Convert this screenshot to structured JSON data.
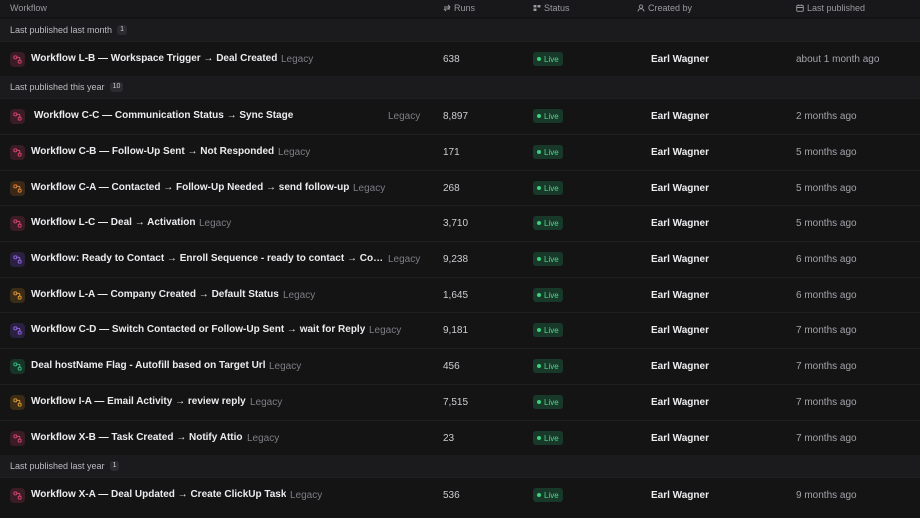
{
  "header": {
    "workflow": "Workflow",
    "runs": "Runs",
    "status": "Status",
    "created_by": "Created by",
    "last_published": "Last published"
  },
  "groups": [
    {
      "label": "Last published last month",
      "count": "1"
    },
    {
      "label": "Last published this year",
      "count": "10"
    },
    {
      "label": "Last published last year",
      "count": "1"
    }
  ],
  "rows": [
    {
      "name": "Workflow L-B — Workspace Trigger → Deal Created",
      "legacy": "Legacy",
      "runs": "638",
      "status": "Live",
      "creator": "Earl Wagner",
      "published": "about 1 month ago",
      "icon_color": "#e24a72",
      "icon_bg": "#3a1c26",
      "icon": "workflow-icon"
    },
    {
      "name": "Workflow C-C — Communication Status → Sync Stage",
      "legacy": "Legacy",
      "runs": "8,897",
      "status": "Live",
      "creator": "Earl Wagner",
      "published": "2 months ago",
      "icon_color": "#e24a72",
      "icon_bg": "#3a1c26",
      "icon": "workflow-icon"
    },
    {
      "name": "Workflow C-B — Follow-Up Sent → Not Responded",
      "legacy": "Legacy",
      "runs": "171",
      "status": "Live",
      "creator": "Earl Wagner",
      "published": "5 months ago",
      "icon_color": "#e24a72",
      "icon_bg": "#3a1c26",
      "icon": "workflow-icon"
    },
    {
      "name": "Workflow C-A — Contacted → Follow-Up Needed → send follow-up",
      "legacy": "Legacy",
      "runs": "268",
      "status": "Live",
      "creator": "Earl Wagner",
      "published": "5 months ago",
      "icon_color": "#f08a3a",
      "icon_bg": "#3a2818",
      "icon": "workflow-icon"
    },
    {
      "name": "Workflow L-C — Deal → Activation",
      "legacy": "Legacy",
      "runs": "3,710",
      "status": "Live",
      "creator": "Earl Wagner",
      "published": "5 months ago",
      "icon_color": "#e24a72",
      "icon_bg": "#3a1c26",
      "icon": "workflow-icon"
    },
    {
      "name": "Workflow: Ready to Contact → Enroll Sequence - ready to contact → Contac...",
      "legacy": "Legacy",
      "runs": "9,238",
      "status": "Live",
      "creator": "Earl Wagner",
      "published": "6 months ago",
      "icon_color": "#9a6cf0",
      "icon_bg": "#2a2040",
      "icon": "workflow-icon"
    },
    {
      "name": "Workflow L-A — Company Created → Default Status",
      "legacy": "Legacy",
      "runs": "1,645",
      "status": "Live",
      "creator": "Earl Wagner",
      "published": "6 months ago",
      "icon_color": "#f0a23a",
      "icon_bg": "#3a2c16",
      "icon": "workflow-icon"
    },
    {
      "name": "Workflow C-D — Switch Contacted or Follow-Up Sent → wait for Reply",
      "legacy": "Legacy",
      "runs": "9,181",
      "status": "Live",
      "creator": "Earl Wagner",
      "published": "7 months ago",
      "icon_color": "#9a6cf0",
      "icon_bg": "#2a2040",
      "icon": "workflow-icon"
    },
    {
      "name": "Deal hostName Flag - Autofill based on Target Url",
      "legacy": "Legacy",
      "runs": "456",
      "status": "Live",
      "creator": "Earl Wagner",
      "published": "7 months ago",
      "icon_color": "#3fc48a",
      "icon_bg": "#173428",
      "icon": "workflow-icon"
    },
    {
      "name": "Workflow I-A — Email Activity → review reply",
      "legacy": "Legacy",
      "runs": "7,515",
      "status": "Live",
      "creator": "Earl Wagner",
      "published": "7 months ago",
      "icon_color": "#f0a23a",
      "icon_bg": "#3a2c16",
      "icon": "workflow-icon"
    },
    {
      "name": "Workflow X-B — Task Created → Notify Attio",
      "legacy": "Legacy",
      "runs": "23",
      "status": "Live",
      "creator": "Earl Wagner",
      "published": "7 months ago",
      "icon_color": "#e24a72",
      "icon_bg": "#3a1c26",
      "icon": "workflow-icon"
    },
    {
      "name": "Workflow X-A — Deal Updated → Create ClickUp Task",
      "legacy": "Legacy",
      "runs": "536",
      "status": "Live",
      "creator": "Earl Wagner",
      "published": "9 months ago",
      "icon_color": "#e24a72",
      "icon_bg": "#3a1c26",
      "icon": "workflow-icon"
    }
  ]
}
